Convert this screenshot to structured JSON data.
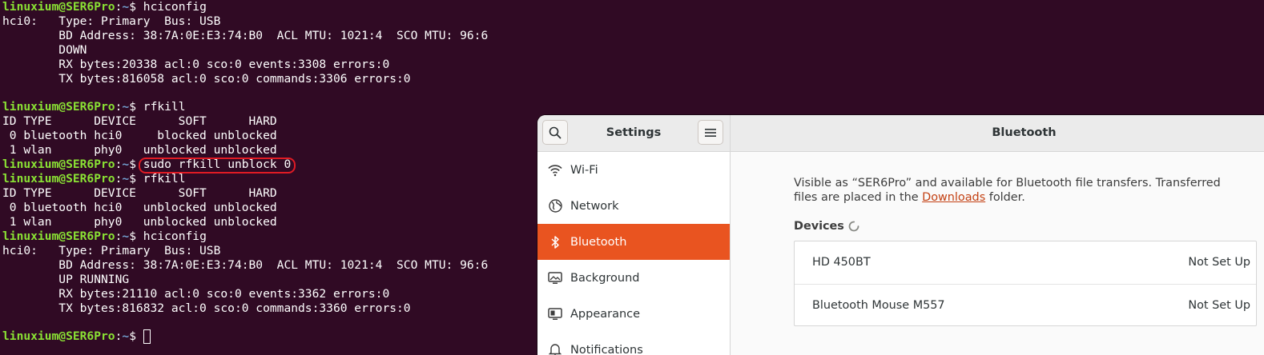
{
  "terminal": {
    "prompt_user": "linuxium@SER6Pro",
    "prompt_path": "~",
    "prompt_symbol": "$",
    "lines": {
      "l0_cmd": "hciconfig",
      "l1": "hci0:   Type: Primary  Bus: USB",
      "l2": "        BD Address: 38:7A:0E:E3:74:B0  ACL MTU: 1021:4  SCO MTU: 96:6",
      "l3": "        DOWN",
      "l4": "        RX bytes:20338 acl:0 sco:0 events:3308 errors:0",
      "l5": "        TX bytes:816058 acl:0 sco:0 commands:3306 errors:0",
      "l7_cmd": "rfkill",
      "l8": "ID TYPE      DEVICE      SOFT      HARD",
      "l9": " 0 bluetooth hci0     blocked unblocked",
      "l10": " 1 wlan      phy0   unblocked unblocked",
      "l11_cmd": "sudo rfkill unblock 0",
      "l12_cmd": "rfkill",
      "l13": "ID TYPE      DEVICE      SOFT      HARD",
      "l14": " 0 bluetooth hci0   unblocked unblocked",
      "l15": " 1 wlan      phy0   unblocked unblocked",
      "l16_cmd": "hciconfig",
      "l17": "hci0:   Type: Primary  Bus: USB",
      "l18": "        BD Address: 38:7A:0E:E3:74:B0  ACL MTU: 1021:4  SCO MTU: 96:6",
      "l19": "        UP RUNNING",
      "l20": "        RX bytes:21110 acl:0 sco:0 events:3362 errors:0",
      "l21": "        TX bytes:816832 acl:0 sco:0 commands:3360 errors:0"
    },
    "colors": {
      "background": "#300a24",
      "prompt_user": "#8ae234",
      "prompt_path": "#729fcf",
      "highlight_ring": "#e01b24"
    }
  },
  "settings": {
    "sidebar_title": "Settings",
    "sidebar_items": [
      {
        "label": "Wi-Fi",
        "icon": "wifi-icon"
      },
      {
        "label": "Network",
        "icon": "network-icon"
      },
      {
        "label": "Bluetooth",
        "icon": "bluetooth-icon",
        "active": true
      },
      {
        "label": "Background",
        "icon": "background-icon"
      },
      {
        "label": "Appearance",
        "icon": "appearance-icon"
      },
      {
        "label": "Notifications",
        "icon": "notifications-icon"
      }
    ],
    "page_title": "Bluetooth",
    "bluetooth_enabled": true,
    "close_symbol": "–",
    "description_pre": "Visible as “SER6Pro” and available for Bluetooth file transfers. Transferred files are placed in the ",
    "description_link": "Downloads",
    "description_post": " folder.",
    "devices_label": "Devices",
    "devices": [
      {
        "name": "HD 450BT",
        "status": "Not Set Up"
      },
      {
        "name": "Bluetooth Mouse M557",
        "status": "Not Set Up"
      }
    ],
    "colors": {
      "accent": "#e95420",
      "link": "#c34113"
    }
  }
}
